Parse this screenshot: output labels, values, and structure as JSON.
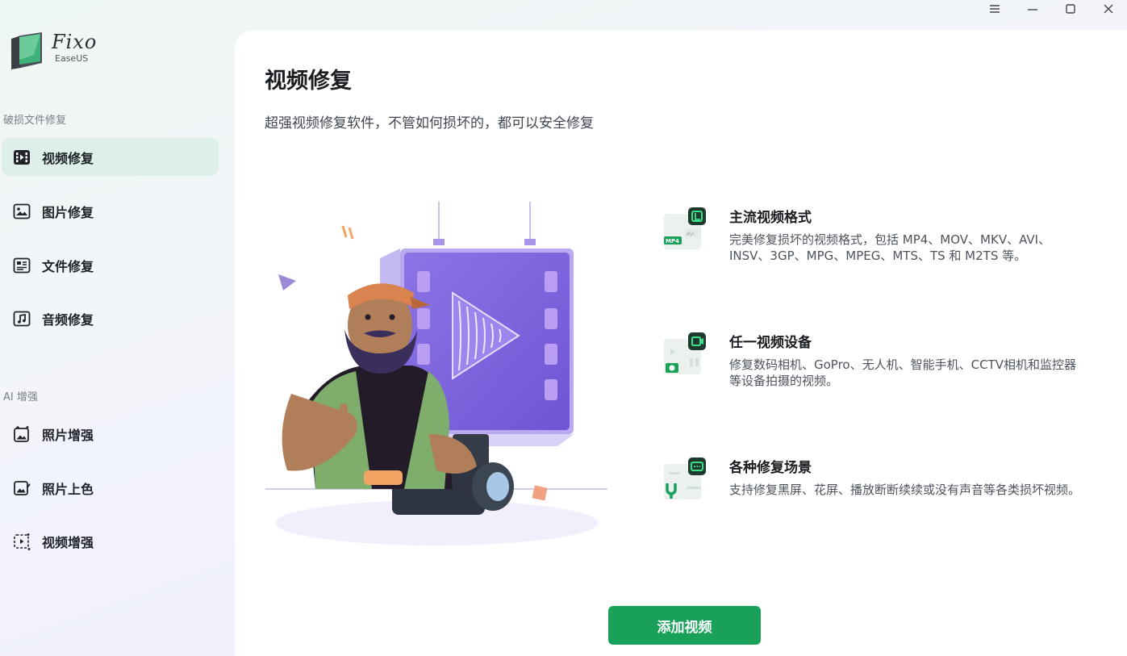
{
  "window": {
    "menu_icon": "menu-icon",
    "minimize_icon": "minimize-icon",
    "maximize_icon": "maximize-icon",
    "close_icon": "close-icon"
  },
  "app": {
    "logo_name": "Fixo",
    "logo_vendor": "EaseUS"
  },
  "sidebar": {
    "section1": "破损文件修复",
    "items1": [
      {
        "label": "视频修复",
        "icon": "video-film-icon",
        "active": true
      },
      {
        "label": "图片修复",
        "icon": "image-icon",
        "active": false
      },
      {
        "label": "文件修复",
        "icon": "document-icon",
        "active": false
      },
      {
        "label": "音频修复",
        "icon": "music-icon",
        "active": false
      }
    ],
    "section2": "AI 增强",
    "items2": [
      {
        "label": "照片增强",
        "icon": "photo-enhance-icon"
      },
      {
        "label": "照片上色",
        "icon": "photo-colorize-icon"
      },
      {
        "label": "视频增强",
        "icon": "video-enhance-icon"
      }
    ]
  },
  "main": {
    "title": "视频修复",
    "subtitle": "超强视频修复软件，不管如何损坏的，都可以安全修复",
    "features": [
      {
        "title": "主流视频格式",
        "desc": "完美修复损坏的视频格式，包括 MP4、MOV、MKV、AVI、INSV、3GP、MPG、MPEG、MTS、TS 和 M2TS 等。",
        "icon": "video-format-icon"
      },
      {
        "title": "任一视频设备",
        "desc": "修复数码相机、GoPro、无人机、智能手机、CCTV相机和监控器等设备拍摄的视频。",
        "icon": "video-device-icon"
      },
      {
        "title": "各种修复场景",
        "desc": "支持修复黑屏、花屏、播放断断续续或没有声音等各类损坏视频。",
        "icon": "repair-scene-icon"
      }
    ],
    "add_button": "添加视频"
  },
  "colors": {
    "accent": "#19a15a",
    "active_bg": "#ddefe8",
    "purple": "#8a6ee0"
  }
}
